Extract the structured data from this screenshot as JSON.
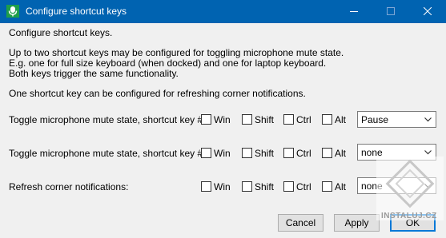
{
  "window": {
    "title": "Configure shortcut keys",
    "controls": [
      "minimize-icon",
      "maximize-icon",
      "close-icon"
    ]
  },
  "content": {
    "heading": "Configure shortcut keys.",
    "desc_line1": "Up to two shortcut keys may be configured for toggling microphone mute state.",
    "desc_line2": "E.g. one for full size keyboard (when docked) and one for laptop keyboard.",
    "desc_line3": "Both keys trigger the same functionality.",
    "refresh_note": "One shortcut key can be configured for refreshing corner notifications."
  },
  "rows": [
    {
      "label": "Toggle microphone mute state, shortcut key #1:",
      "modifiers": {
        "win": "Win",
        "shift": "Shift",
        "ctrl": "Ctrl",
        "alt": "Alt"
      },
      "key": "Pause"
    },
    {
      "label": "Toggle microphone mute state, shortcut key #2:",
      "modifiers": {
        "win": "Win",
        "shift": "Shift",
        "ctrl": "Ctrl",
        "alt": "Alt"
      },
      "key": "none"
    },
    {
      "label": "Refresh corner notifications:",
      "modifiers": {
        "win": "Win",
        "shift": "Shift",
        "ctrl": "Ctrl",
        "alt": "Alt"
      },
      "key": "none"
    }
  ],
  "buttons": {
    "cancel": "Cancel",
    "apply": "Apply",
    "ok": "OK"
  },
  "watermark": {
    "text": "INSTALUJ.CZ"
  },
  "colors": {
    "titlebar": "#0063b1",
    "accent": "#0078d7",
    "background": "#f0f0f0"
  }
}
